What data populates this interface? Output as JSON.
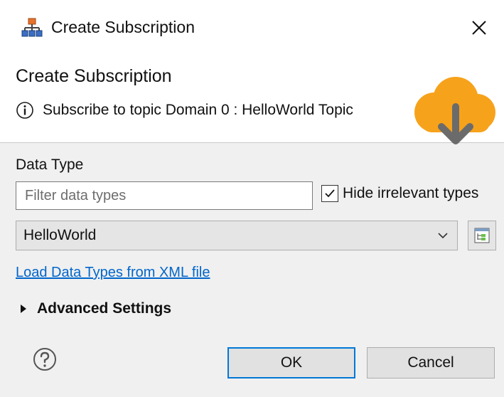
{
  "window": {
    "title": "Create Subscription",
    "icon": "network-tree-icon",
    "close_icon": "close-icon"
  },
  "header": {
    "title": "Create Subscription",
    "message": "Subscribe to topic Domain 0 : HelloWorld Topic",
    "message_icon": "info-icon",
    "banner_icon": "cloud-download-icon",
    "colors": {
      "cloud": "#f7a21b",
      "arrow": "#6b6b6b"
    }
  },
  "data_type": {
    "label": "Data Type",
    "filter_placeholder": "Filter data types",
    "filter_value": "",
    "hide_irrelevant_label": "Hide irrelevant types",
    "hide_irrelevant_checked": true,
    "selected_type": "HelloWorld",
    "type_browser_icon": "type-tree-icon"
  },
  "links": {
    "load_xml": "Load Data Types from XML file"
  },
  "advanced": {
    "label": "Advanced Settings",
    "expanded": false
  },
  "buttons": {
    "help_icon": "help-icon",
    "ok": "OK",
    "cancel": "Cancel"
  },
  "colors": {
    "link": "#0066cc",
    "default_button_border": "#0078d7",
    "background": "#f0f0f0"
  }
}
